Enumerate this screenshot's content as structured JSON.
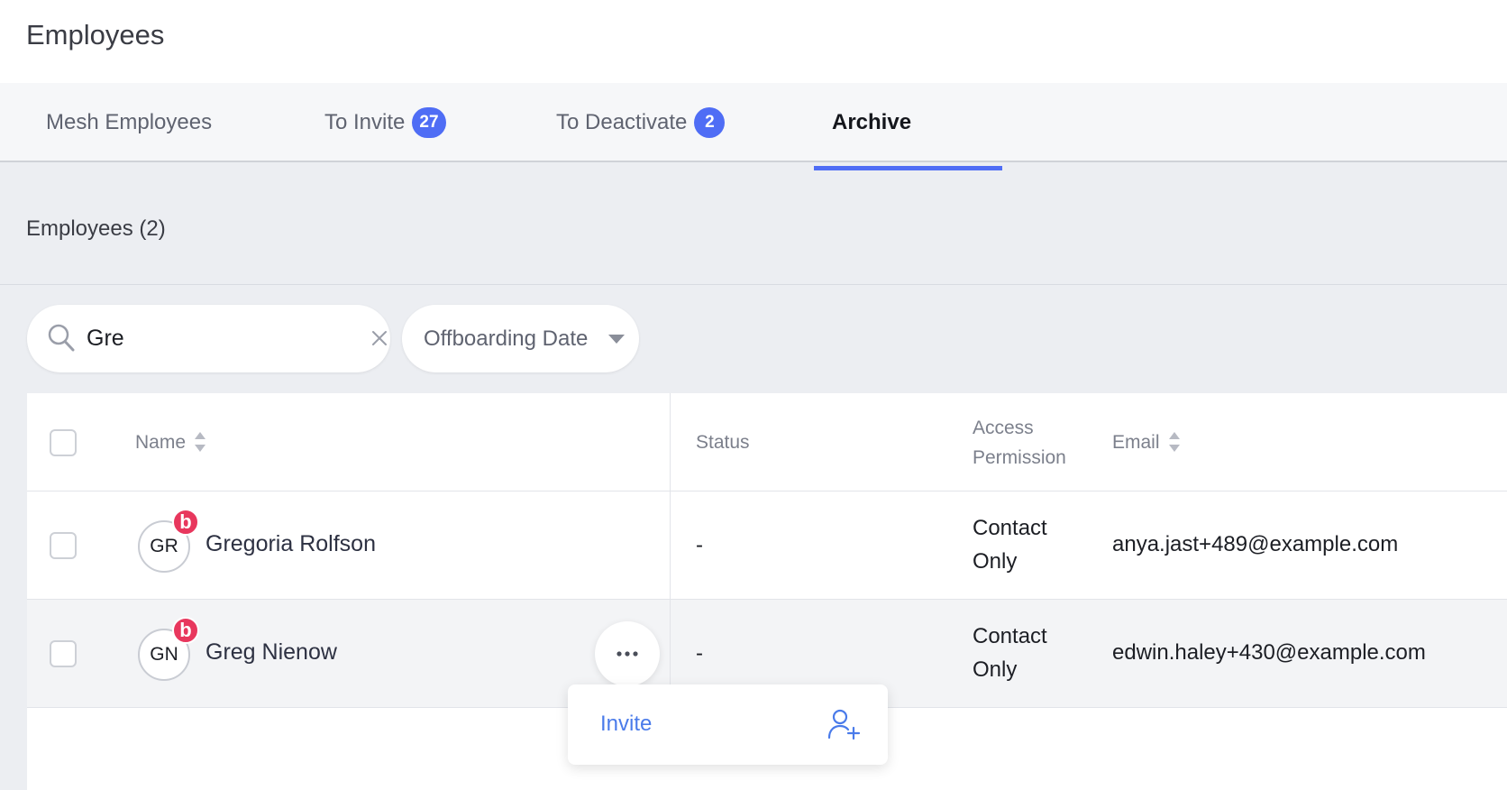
{
  "header": {
    "title": "Employees"
  },
  "tabs": [
    {
      "label": "Mesh Employees",
      "badge": null,
      "active": false
    },
    {
      "label": "To Invite",
      "badge": "27",
      "active": false
    },
    {
      "label": "To Deactivate",
      "badge": "2",
      "active": false
    },
    {
      "label": "Archive",
      "badge": null,
      "active": true
    }
  ],
  "section": {
    "title": "Employees (2)"
  },
  "search": {
    "value": "Gre",
    "icon": "search-icon",
    "clear_icon": "close-icon"
  },
  "filter": {
    "label": "Offboarding Date",
    "icon": "chevron-down-icon"
  },
  "table": {
    "columns": {
      "name": "Name",
      "status": "Status",
      "access_line1": "Access",
      "access_line2": "Permission",
      "email": "Email"
    },
    "rows": [
      {
        "initials": "GR",
        "badge": "b",
        "name": "Gregoria Rolfson",
        "status": "-",
        "access_line1": "Contact",
        "access_line2": "Only",
        "email": "anya.jast+489@example.com"
      },
      {
        "initials": "GN",
        "badge": "b",
        "name": "Greg Nienow",
        "status": "-",
        "access_line1": "Contact",
        "access_line2": "Only",
        "email": "edwin.haley+430@example.com"
      }
    ]
  },
  "row_menu": {
    "more_icon": "more-horizontal-icon",
    "items": [
      {
        "label": "Invite",
        "icon": "add-user-icon"
      }
    ]
  },
  "colors": {
    "accent": "#4f6df5",
    "badge_red": "#e8375d",
    "link_blue": "#4a7bea"
  }
}
